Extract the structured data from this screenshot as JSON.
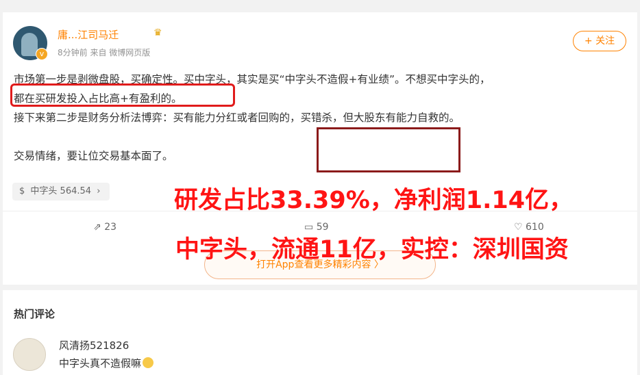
{
  "post": {
    "username": "庸...江司马迁",
    "meta": "8分钟前 来自 微博网页版",
    "follow_label": "+ 关注",
    "lines": [
      "市场第一步是剥微盘股，买确定性。买中字头，其实是买“中字头不造假+有业绩”。不想买中字头的，",
      "都在买研发投入占比高+有盈利的。",
      "接下来第二步是财务分析法博弈：买有能力分红或者回购的，买错杀，但大股东有能力自救的。",
      "交易情绪，要让位交易基本面了。"
    ],
    "stock_tag": {
      "symbol": "$",
      "label": "中字头 564.54",
      "arrow": "›"
    },
    "actions": {
      "repost": "23",
      "comments": "59",
      "likes": "610"
    },
    "open_app": "打开App查看更多精彩内容 〉"
  },
  "overlay": {
    "line1": "研发占比33.39%，净利润1.14亿，",
    "line2": "中字头，流通11亿，实控：深圳国资"
  },
  "hot_comments": {
    "title": "热门评论",
    "items": [
      {
        "user": "风清扬521826",
        "text": "中字头真不造假嘛"
      }
    ]
  },
  "colors": {
    "accent": "#ff8200",
    "highlight": "#e01b1b",
    "overlay_text": "#ff1414"
  }
}
